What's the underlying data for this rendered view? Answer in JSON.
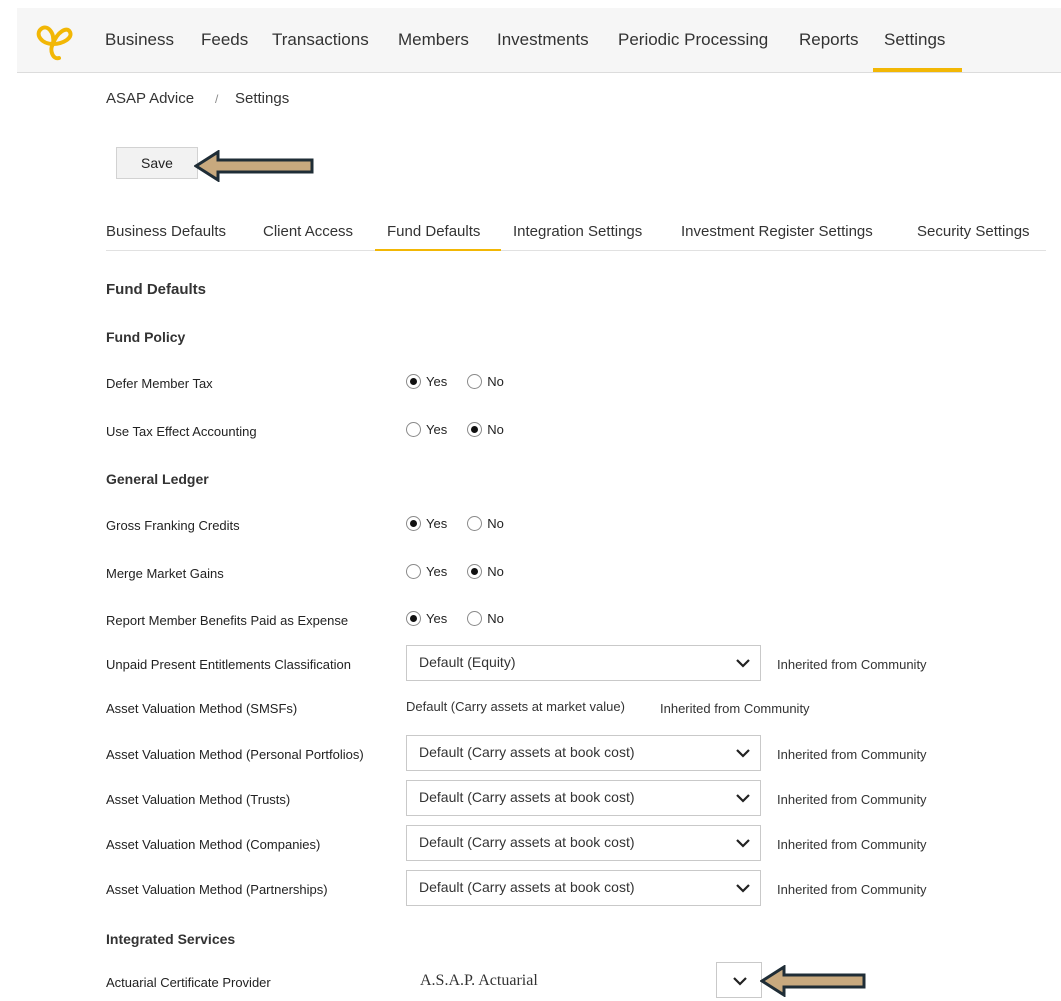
{
  "nav": {
    "items": [
      "Business",
      "Feeds",
      "Transactions",
      "Members",
      "Investments",
      "Periodic Processing",
      "Reports",
      "Settings"
    ],
    "active": "Settings",
    "accent_color": "#f2b705"
  },
  "breadcrumb": {
    "parent": "ASAP Advice",
    "separator": "/",
    "current": "Settings"
  },
  "toolbar": {
    "save_label": "Save"
  },
  "tabs": {
    "items": [
      "Business Defaults",
      "Client Access",
      "Fund Defaults",
      "Integration Settings",
      "Investment Register Settings",
      "Security Settings"
    ],
    "active": "Fund Defaults"
  },
  "content": {
    "title": "Fund Defaults",
    "fund_policy": {
      "heading": "Fund Policy",
      "defer_member_tax": {
        "label": "Defer Member Tax",
        "value": "Yes"
      },
      "use_tax_effect_accounting": {
        "label": "Use Tax Effect Accounting",
        "value": "No"
      }
    },
    "general_ledger": {
      "heading": "General Ledger",
      "gross_franking_credits": {
        "label": "Gross Franking Credits",
        "value": "Yes"
      },
      "merge_market_gains": {
        "label": "Merge Market Gains",
        "value": "No"
      },
      "report_member_benefits": {
        "label": "Report Member Benefits Paid as Expense",
        "value": "Yes"
      },
      "unpaid_present_entitlements": {
        "label": "Unpaid Present Entitlements Classification",
        "value": "Default (Equity)",
        "note": "Inherited from Community"
      },
      "asset_valuation_smsf": {
        "label": "Asset Valuation Method (SMSFs)",
        "value": "Default (Carry assets at market value)",
        "note": "Inherited from Community"
      },
      "asset_valuation_personal": {
        "label": "Asset Valuation Method (Personal Portfolios)",
        "value": "Default (Carry assets at book cost)",
        "note": "Inherited from Community"
      },
      "asset_valuation_trusts": {
        "label": "Asset Valuation Method (Trusts)",
        "value": "Default (Carry assets at book cost)",
        "note": "Inherited from Community"
      },
      "asset_valuation_companies": {
        "label": "Asset Valuation Method (Companies)",
        "value": "Default (Carry assets at book cost)",
        "note": "Inherited from Community"
      },
      "asset_valuation_partnerships": {
        "label": "Asset Valuation Method (Partnerships)",
        "value": "Default (Carry assets at book cost)",
        "note": "Inherited from Community"
      }
    },
    "integrated_services": {
      "heading": "Integrated Services",
      "actuarial_certificate_provider": {
        "label": "Actuarial Certificate Provider",
        "value": "A.S.A.P. Actuarial"
      }
    }
  },
  "radio_labels": {
    "yes": "Yes",
    "no": "No"
  },
  "colors": {
    "arrow_fill": "#c8a97e",
    "arrow_outline": "#1f2d36"
  }
}
